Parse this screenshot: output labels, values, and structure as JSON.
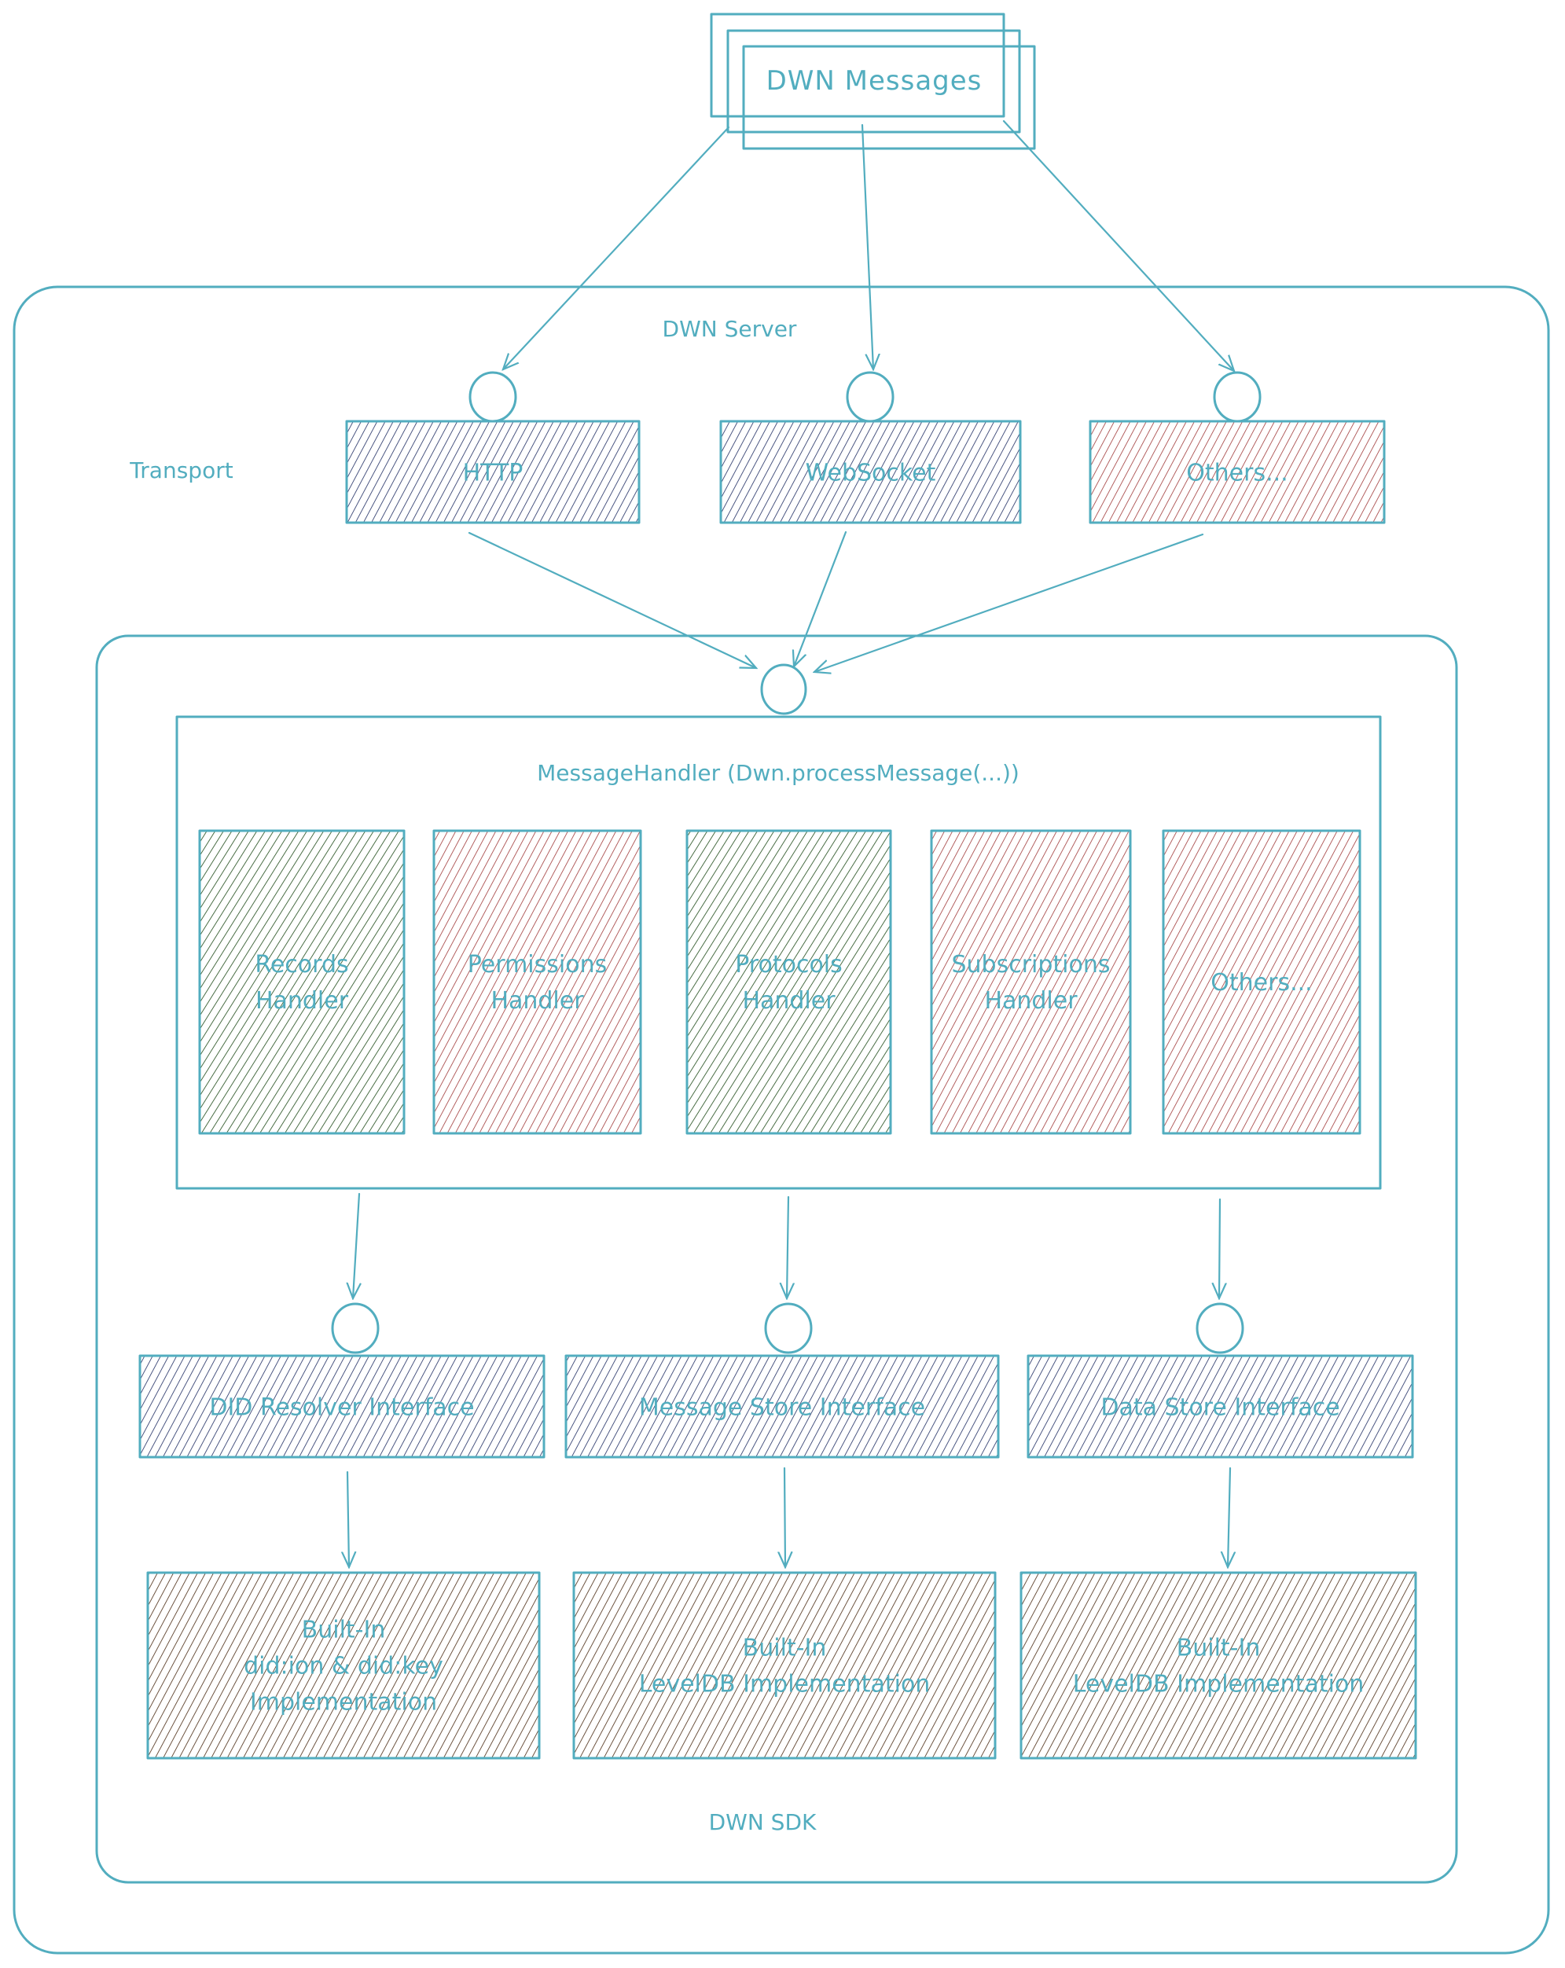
{
  "diagram": {
    "title": "DWN Messages",
    "colors": {
      "stroke": "#52adbf",
      "text": "#52adbf",
      "hatch_blue": "#1f2d63",
      "hatch_red": "#9b2e2e",
      "hatch_green": "#1d4a17",
      "hatch_brown": "#4a2a12"
    },
    "server": {
      "label": "DWN Server",
      "transport_label": "Transport",
      "transports": [
        {
          "label": "HTTP",
          "fill": "blue"
        },
        {
          "label": "WebSocket",
          "fill": "blue"
        },
        {
          "label": "Others...",
          "fill": "red"
        }
      ]
    },
    "sdk": {
      "label": "DWN SDK",
      "message_handler": {
        "label": "MessageHandler (Dwn.processMessage(...))",
        "handlers": [
          {
            "lines": [
              "Records",
              "Handler"
            ],
            "fill": "green"
          },
          {
            "lines": [
              "Permissions",
              "Handler"
            ],
            "fill": "red"
          },
          {
            "lines": [
              "Protocols",
              "Handler"
            ],
            "fill": "green"
          },
          {
            "lines": [
              "Subscriptions",
              "Handler"
            ],
            "fill": "red"
          },
          {
            "lines": [
              "Others..."
            ],
            "fill": "red"
          }
        ]
      },
      "interfaces": [
        {
          "label": "DID Resolver Interface",
          "fill": "blue"
        },
        {
          "label": "Message Store Interface",
          "fill": "blue"
        },
        {
          "label": "Data Store Interface",
          "fill": "blue"
        }
      ],
      "implementations": [
        {
          "lines": [
            "Built-In",
            "did:ion & did:key",
            "Implementation"
          ],
          "fill": "brown"
        },
        {
          "lines": [
            "Built-In",
            "LevelDB Implementation"
          ],
          "fill": "brown"
        },
        {
          "lines": [
            "Built-In",
            "LevelDB Implementation"
          ],
          "fill": "brown"
        }
      ]
    }
  }
}
